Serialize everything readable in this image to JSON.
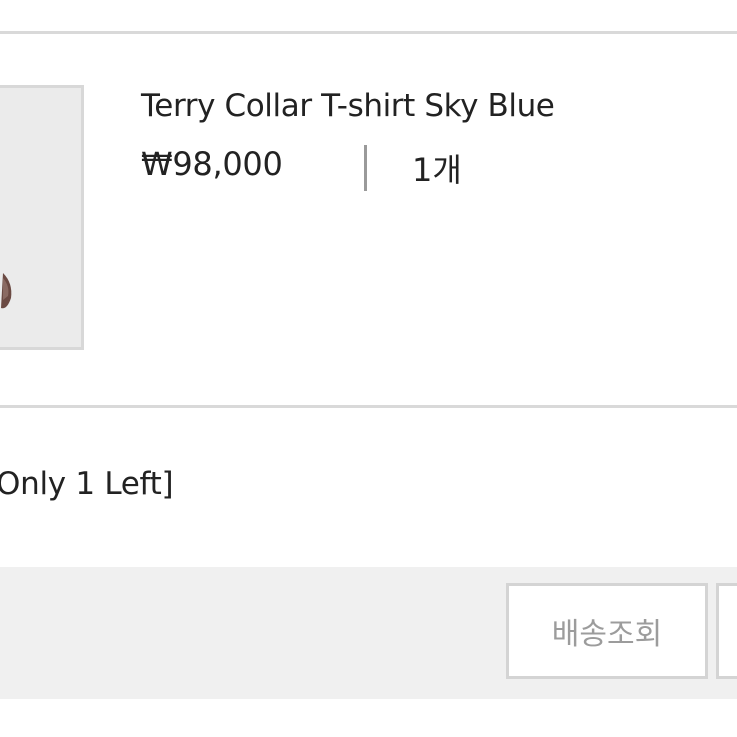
{
  "order_item": {
    "product_name": "Terry Collar T-shirt Sky Blue",
    "price": "₩98,000",
    "quantity": "1개",
    "note": "Only 1 Left]"
  },
  "actions": {
    "track_delivery_label": "배송조회",
    "next_label": ""
  },
  "colors": {
    "divider": "#d9d9d9",
    "thumbnail_bg": "#ebebeb",
    "action_bar_bg": "#f0f0f0",
    "button_text": "#9c9c9c",
    "text": "#222222"
  },
  "icons": {
    "product_thumbnail": "product-image"
  }
}
